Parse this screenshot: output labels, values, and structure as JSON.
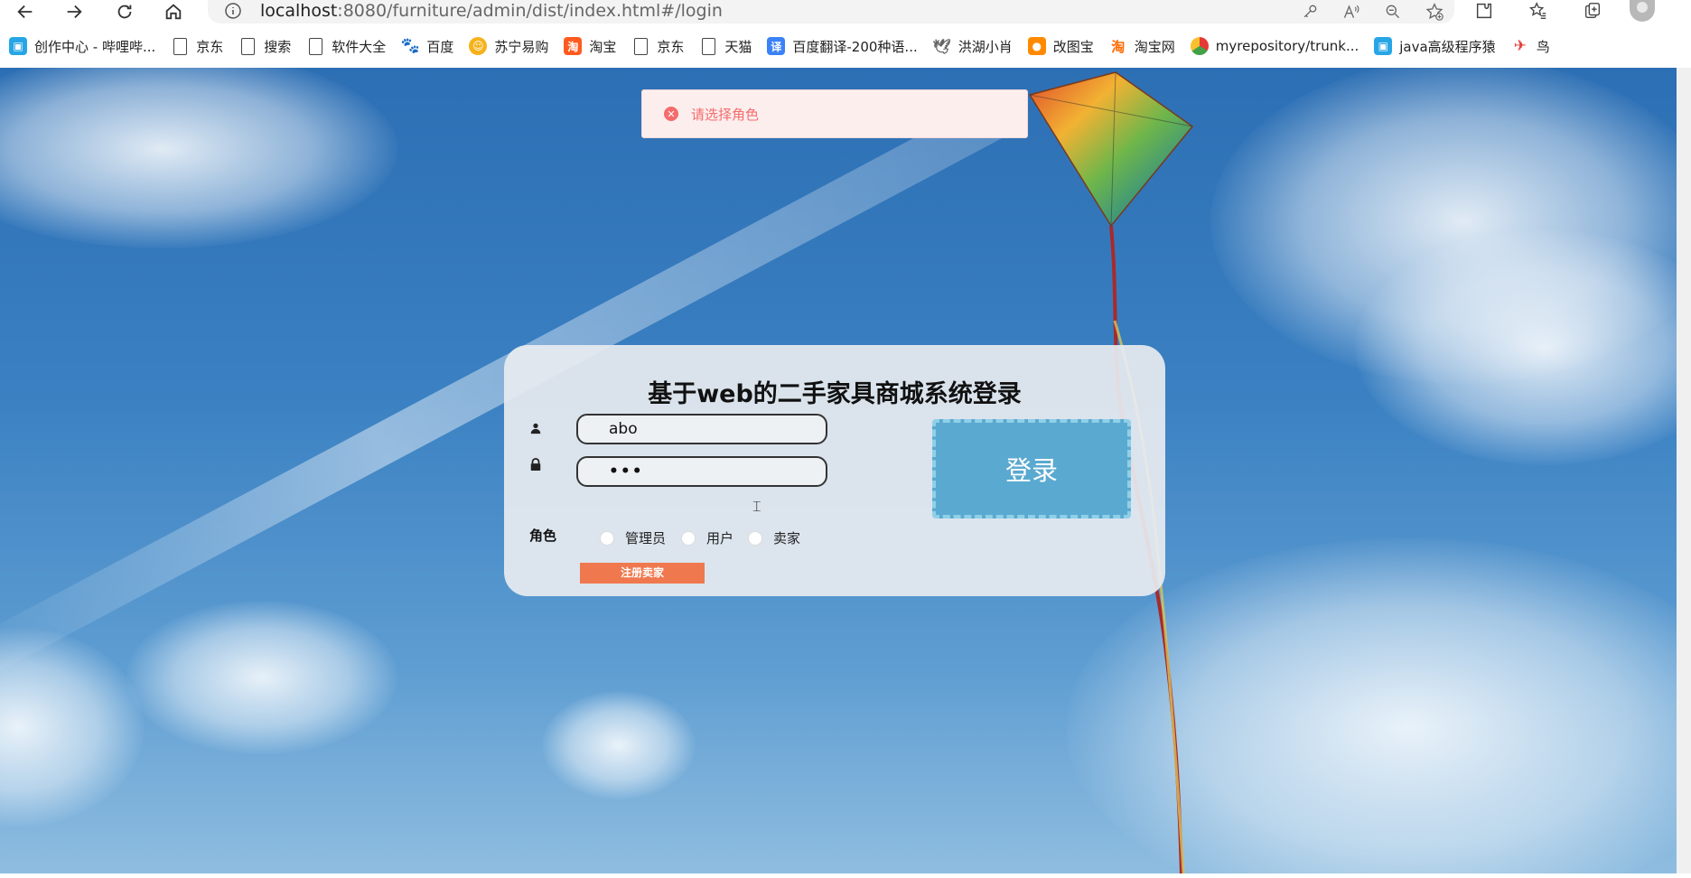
{
  "browser": {
    "url_host": "localhost",
    "url_rest": ":8080/furniture/admin/dist/index.html#/login"
  },
  "bookmarks": [
    {
      "label": "创作中心 - 哔哩哔...",
      "icon": "tv-icon"
    },
    {
      "label": "京东",
      "icon": "page-icon"
    },
    {
      "label": "搜索",
      "icon": "page-icon"
    },
    {
      "label": "软件大全",
      "icon": "page-icon"
    },
    {
      "label": "百度",
      "icon": "paw-icon"
    },
    {
      "label": "苏宁易购",
      "icon": "suning-icon"
    },
    {
      "label": "淘宝",
      "icon": "taobao-icon"
    },
    {
      "label": "京东",
      "icon": "page-icon"
    },
    {
      "label": "天猫",
      "icon": "page-icon"
    },
    {
      "label": "百度翻译-200种语...",
      "icon": "translate-icon"
    },
    {
      "label": "洪湖小肖",
      "icon": "bird-icon"
    },
    {
      "label": "改图宝",
      "icon": "gaitubao-icon"
    },
    {
      "label": "淘宝网",
      "icon": "taobao-icon"
    },
    {
      "label": "myrepository/trunk...",
      "icon": "chrome-icon"
    },
    {
      "label": "java高级程序猿",
      "icon": "tv-icon"
    },
    {
      "label": "鸟",
      "icon": "bird-icon"
    }
  ],
  "toast": {
    "message": "请选择角色",
    "color": "#f56c6c"
  },
  "login": {
    "title": "基于web的二手家具商城系统登录",
    "username_value": "abo",
    "password_value": "•••",
    "role_label": "角色",
    "roles": [
      "管理员",
      "用户",
      "卖家"
    ],
    "register_label": "注册卖家",
    "login_label": "登录"
  },
  "colors": {
    "login_button": "#5aa9d0",
    "register_button": "#f0784e"
  }
}
